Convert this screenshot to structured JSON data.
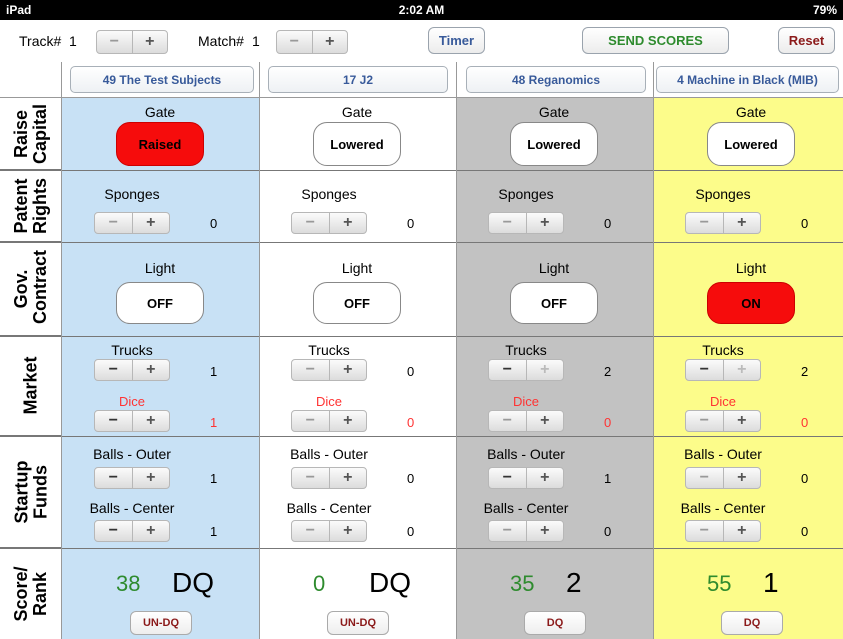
{
  "status": {
    "device": "iPad",
    "time": "2:02 AM",
    "battery": "79%"
  },
  "top": {
    "track_label": "Track#",
    "track_value": "1",
    "match_label": "Match#",
    "match_value": "1",
    "timer_label": "Timer",
    "send_label": "SEND SCORES",
    "reset_label": "Reset"
  },
  "rows": {
    "raise": "Raise Capital",
    "patent": "Patent Rights",
    "gov": "Gov. Contract",
    "market": "Market",
    "startup": "Startup Funds",
    "score": "Score/ Rank"
  },
  "teams": [
    {
      "name": "49 The Test Subjects",
      "bg": "#c8e1f5",
      "gate_label": "Gate",
      "gate": "Raised",
      "sponges_label": "Sponges",
      "sponges": "0",
      "light_label": "Light",
      "light": "OFF",
      "trucks_label": "Trucks",
      "trucks": "1",
      "dice_label": "Dice",
      "dice": "1",
      "outer_label": "Balls - Outer",
      "outer": "1",
      "center_label": "Balls - Center",
      "center": "1",
      "score": "38",
      "rank": "DQ",
      "dq_button": "UN-DQ"
    },
    {
      "name": "17 J2",
      "bg": "#ffffff",
      "gate_label": "Gate",
      "gate": "Lowered",
      "sponges_label": "Sponges",
      "sponges": "0",
      "light_label": "Light",
      "light": "OFF",
      "trucks_label": "Trucks",
      "trucks": "0",
      "dice_label": "Dice",
      "dice": "0",
      "outer_label": "Balls - Outer",
      "outer": "0",
      "center_label": "Balls - Center",
      "center": "0",
      "score": "0",
      "rank": "DQ",
      "dq_button": "UN-DQ"
    },
    {
      "name": "48 Reganomics",
      "bg": "#c2c2c2",
      "gate_label": "Gate",
      "gate": "Lowered",
      "sponges_label": "Sponges",
      "sponges": "0",
      "light_label": "Light",
      "light": "OFF",
      "trucks_label": "Trucks",
      "trucks": "2",
      "dice_label": "Dice",
      "dice": "0",
      "outer_label": "Balls - Outer",
      "outer": "1",
      "center_label": "Balls - Center",
      "center": "0",
      "score": "35",
      "rank": "2",
      "dq_button": "DQ"
    },
    {
      "name": "4 Machine in Black (MIB)",
      "bg": "#fcfc8a",
      "gate_label": "Gate",
      "gate": "Lowered",
      "sponges_label": "Sponges",
      "sponges": "0",
      "light_label": "Light",
      "light": "ON",
      "trucks_label": "Trucks",
      "trucks": "2",
      "dice_label": "Dice",
      "dice": "0",
      "outer_label": "Balls - Outer",
      "outer": "0",
      "center_label": "Balls - Center",
      "center": "0",
      "score": "55",
      "rank": "1",
      "dq_button": "DQ"
    }
  ],
  "icons": {
    "minus": "−",
    "plus": "+"
  }
}
